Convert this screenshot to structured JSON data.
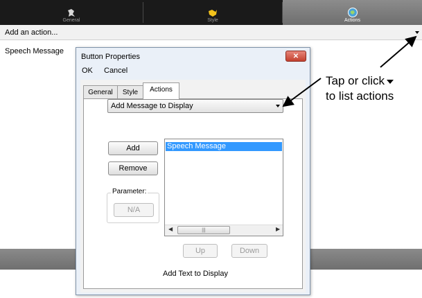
{
  "top_tabs": [
    {
      "label": "General",
      "icon": "general-icon"
    },
    {
      "label": "Style",
      "icon": "style-icon"
    },
    {
      "label": "Actions",
      "icon": "actions-icon",
      "active": true
    }
  ],
  "action_bar": {
    "placeholder": "Add an action...",
    "icon": "chevron-down-icon"
  },
  "action_list": [
    "Speech Message"
  ],
  "dialog": {
    "title": "Button Properties",
    "close_icon": "close-icon",
    "menu": {
      "ok": "OK",
      "cancel": "Cancel"
    },
    "tabs": [
      {
        "label": "General"
      },
      {
        "label": "Style"
      },
      {
        "label": "Actions",
        "active": true
      }
    ],
    "action_select": "Add Message to Display",
    "add_button": "Add",
    "remove_button": "Remove",
    "parameter_label": "Parameter:",
    "parameter_button": "N/A",
    "list_items": [
      "Speech Message"
    ],
    "up_button": "Up",
    "down_button": "Down",
    "footer_text": "Add Text to Display"
  },
  "callout": {
    "line1": "Tap or click",
    "line2": "to list actions",
    "icon": "chevron-down-icon"
  },
  "colors": {
    "selection": "#3399ff",
    "close_button": "#c3412f",
    "top_bar": "#1a1a1a"
  }
}
